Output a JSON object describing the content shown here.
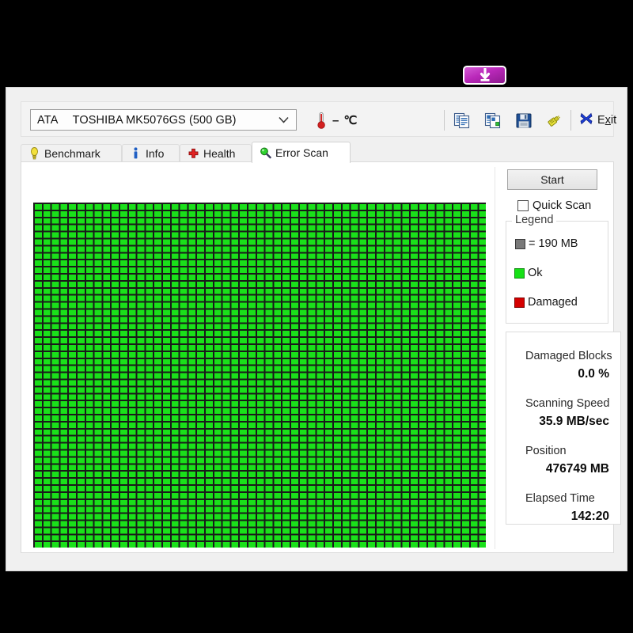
{
  "app": {
    "icon_name": "download-arrow-app-icon"
  },
  "device_bar": {
    "interface": "ATA",
    "model": "TOSHIBA MK5076GS (500 GB)",
    "dropdown_icon": "chevron-down-icon",
    "temperature": "–  ℃",
    "thermometer_icon": "thermometer-icon",
    "toolbar_buttons": [
      {
        "name": "copy-text-icon",
        "title": "Copy text"
      },
      {
        "name": "copy-image-icon",
        "title": "Copy image"
      },
      {
        "name": "save-floppy-icon",
        "title": "Save"
      },
      {
        "name": "connector-plug-icon",
        "title": "Settings"
      }
    ],
    "exit_label_before": "E",
    "exit_label_accel": "x",
    "exit_label_after": "it",
    "exit_icon": "blue-x-close-icon"
  },
  "tabs": [
    {
      "label": "Benchmark",
      "icon": "yellow-bulb-icon",
      "active": false
    },
    {
      "label": "Info",
      "icon": "blue-info-icon",
      "active": false
    },
    {
      "label": "Health",
      "icon": "red-cross-icon",
      "active": false
    },
    {
      "label": "Error Scan",
      "icon": "green-magnifier-icon",
      "active": true
    }
  ],
  "error_scan": {
    "start_button": "Start",
    "quick_scan_label": "Quick Scan",
    "quick_scan_checked": false,
    "legend": {
      "title": "Legend",
      "items": [
        {
          "swatch": "gray",
          "label": "= 190 MB"
        },
        {
          "swatch": "green",
          "label": "Ok"
        },
        {
          "swatch": "red",
          "label": "Damaged"
        }
      ]
    },
    "stats": [
      {
        "label": "Damaged Blocks",
        "value": "0.0 %"
      },
      {
        "label": "Scanning Speed",
        "value": "35.9 MB/sec"
      },
      {
        "label": "Position",
        "value": "476749 MB"
      },
      {
        "label": "Elapsed Time",
        "value": "142:20"
      }
    ],
    "map": {
      "columns": 53,
      "rows": 49,
      "block_size_mb": 190,
      "ok_color": "#1ae01a",
      "damaged_color": "#d50000",
      "unscanned_color": "#797979",
      "all_blocks_state": "Ok"
    }
  }
}
